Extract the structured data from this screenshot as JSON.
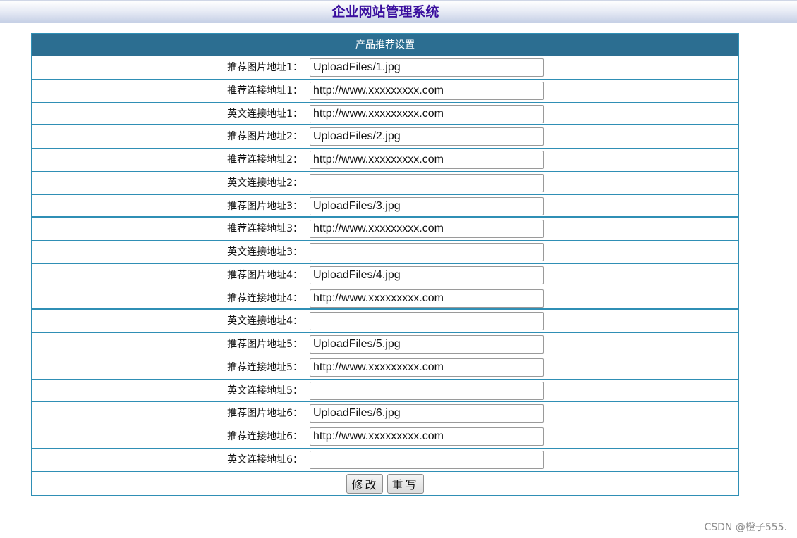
{
  "app": {
    "title": "企业网站管理系统"
  },
  "panel": {
    "header": "产品推荐设置"
  },
  "rows": [
    {
      "label": "推荐图片地址1：",
      "value": "UploadFiles/1.jpg"
    },
    {
      "label": "推荐连接地址1：",
      "value": "http://www.xxxxxxxxx.com"
    },
    {
      "label": "英文连接地址1：",
      "value": "http://www.xxxxxxxxx.com"
    },
    {
      "label": "推荐图片地址2：",
      "value": "UploadFiles/2.jpg"
    },
    {
      "label": "推荐连接地址2：",
      "value": "http://www.xxxxxxxxx.com"
    },
    {
      "label": "英文连接地址2：",
      "value": ""
    },
    {
      "label": "推荐图片地址3：",
      "value": "UploadFiles/3.jpg"
    },
    {
      "label": "推荐连接地址3：",
      "value": "http://www.xxxxxxxxx.com"
    },
    {
      "label": "英文连接地址3：",
      "value": ""
    },
    {
      "label": "推荐图片地址4：",
      "value": "UploadFiles/4.jpg"
    },
    {
      "label": "推荐连接地址4：",
      "value": "http://www.xxxxxxxxx.com"
    },
    {
      "label": "英文连接地址4：",
      "value": ""
    },
    {
      "label": "推荐图片地址5：",
      "value": "UploadFiles/5.jpg"
    },
    {
      "label": "推荐连接地址5：",
      "value": "http://www.xxxxxxxxx.com"
    },
    {
      "label": "英文连接地址5：",
      "value": ""
    },
    {
      "label": "推荐图片地址6：",
      "value": "UploadFiles/6.jpg"
    },
    {
      "label": "推荐连接地址6：",
      "value": "http://www.xxxxxxxxx.com"
    },
    {
      "label": "英文连接地址6：",
      "value": ""
    }
  ],
  "buttons": {
    "submit_label": "修改",
    "reset_label": "重写"
  },
  "watermark": "CSDN @橙子555."
}
